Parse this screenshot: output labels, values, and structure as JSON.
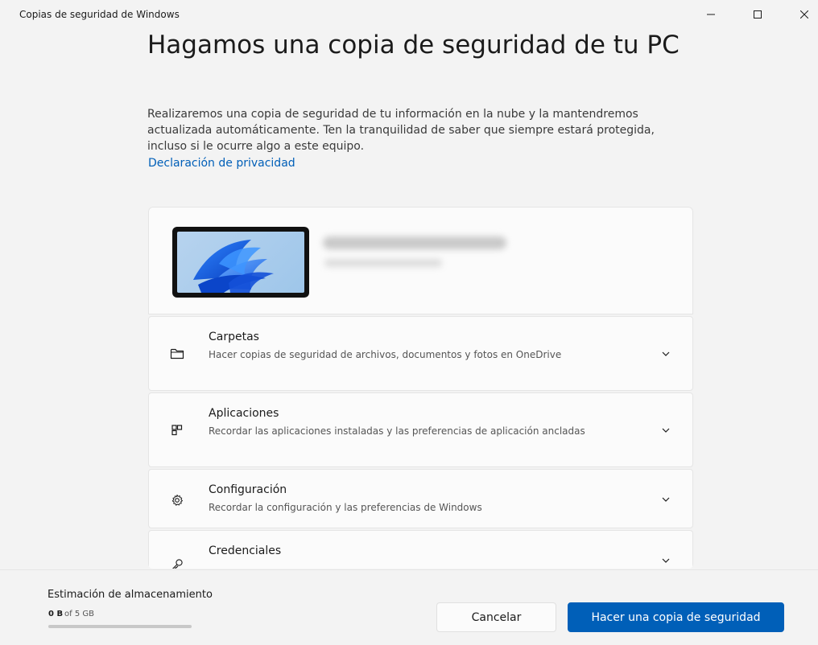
{
  "window": {
    "app_title": "Copias de seguridad de Windows"
  },
  "header": {
    "title": "Hagamos una copia de seguridad de tu PC",
    "description": "Realizaremos una copia de seguridad de tu información en la nube y la mantendremos actualizada automáticamente. Ten la tranquilidad de saber que siempre estará protegida, incluso si le ocurre algo a este equipo.",
    "privacy_link": "Declaración de privacidad"
  },
  "backup_items": [
    {
      "title": "Carpetas",
      "description": "Hacer copias de seguridad de archivos, documentos y fotos en OneDrive",
      "icon": "folder-icon"
    },
    {
      "title": "Aplicaciones",
      "description": "Recordar las aplicaciones instaladas y las preferencias de aplicación ancladas",
      "icon": "apps-icon"
    },
    {
      "title": "Configuración",
      "description": "Recordar la configuración y las preferencias de Windows",
      "icon": "gear-icon"
    },
    {
      "title": "Credenciales",
      "description": "",
      "icon": "key-icon"
    }
  ],
  "footer": {
    "storage_label": "Estimación de almacenamiento",
    "used": "0 B",
    "total": "of 5 GB",
    "usage_fraction": 0,
    "cancel_label": "Cancelar",
    "backup_label": "Hacer una copia de seguridad"
  },
  "colors": {
    "accent": "#005fb8",
    "background": "#f3f3f3",
    "card": "#fbfbfb"
  }
}
